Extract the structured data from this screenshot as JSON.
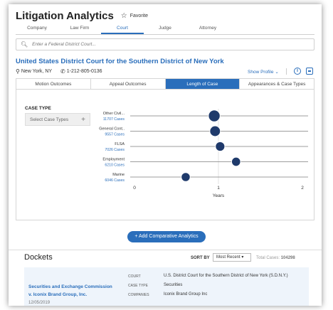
{
  "app": {
    "title": "Litigation Analytics",
    "favorite_label": "Favorite"
  },
  "top_tabs": [
    {
      "label": "Company"
    },
    {
      "label": "Law Firm"
    },
    {
      "label": "Court"
    },
    {
      "label": "Judge"
    },
    {
      "label": "Attorney"
    }
  ],
  "active_top_tab": "Court",
  "search": {
    "placeholder": "Enter a Federal District Court..."
  },
  "court": {
    "name": "United States District Court for the Southern District of New York",
    "location": "New York, NY",
    "phone": "1-212-805-0136",
    "show_profile": "Show Profile"
  },
  "sub_tabs": [
    {
      "label": "Motion Outcomes"
    },
    {
      "label": "Appeal Outcomes"
    },
    {
      "label": "Length of Case"
    },
    {
      "label": "Appearances & Case Types"
    }
  ],
  "active_sub_tab": "Length of Case",
  "filters": {
    "case_type_label": "CASE TYPE",
    "case_type_placeholder": "Select Case Types"
  },
  "chart_data": {
    "type": "scatter",
    "xlabel": "Years",
    "xlim": [
      0,
      2
    ],
    "xticks": [
      "0",
      "1",
      "2"
    ],
    "grid": true,
    "points": [
      {
        "category": "Other Civil...",
        "cases_label": "11707 Cases",
        "years": 0.95,
        "cases": 11707
      },
      {
        "category": "General Cont..",
        "cases_label": "9557 Cases",
        "years": 0.96,
        "cases": 9557
      },
      {
        "category": "FLSA",
        "cases_label": "7026 Cases",
        "years": 1.02,
        "cases": 7026
      },
      {
        "category": "Employment",
        "cases_label": "6210 Cases",
        "years": 1.21,
        "cases": 6210
      },
      {
        "category": "Marine",
        "cases_label": "6046 Cases",
        "years": 0.61,
        "cases": 6046
      }
    ],
    "point_color": "#1f3a6b"
  },
  "add_button": {
    "label": "+ Add Comparative Analytics"
  },
  "dockets": {
    "title": "Dockets",
    "sort_by_label": "SORT BY",
    "sort_value": "Most Recent",
    "total_label": "Total Cases:",
    "total_value": "104298",
    "row": {
      "name": "Securities and Exchange Commission v. Iconix Brand Group, Inc.",
      "date": "12/05/2019",
      "fields": [
        {
          "label": "COURT",
          "value": "U.S. District Court for the Southern District of New York (S.D.N.Y.)"
        },
        {
          "label": "CASE TYPE",
          "value": "Securities"
        },
        {
          "label": "COMPANIES",
          "value": "Iconix Brand Group Inc"
        }
      ]
    }
  },
  "colors": {
    "accent": "#2a6ebb",
    "point": "#1f3a6b"
  }
}
